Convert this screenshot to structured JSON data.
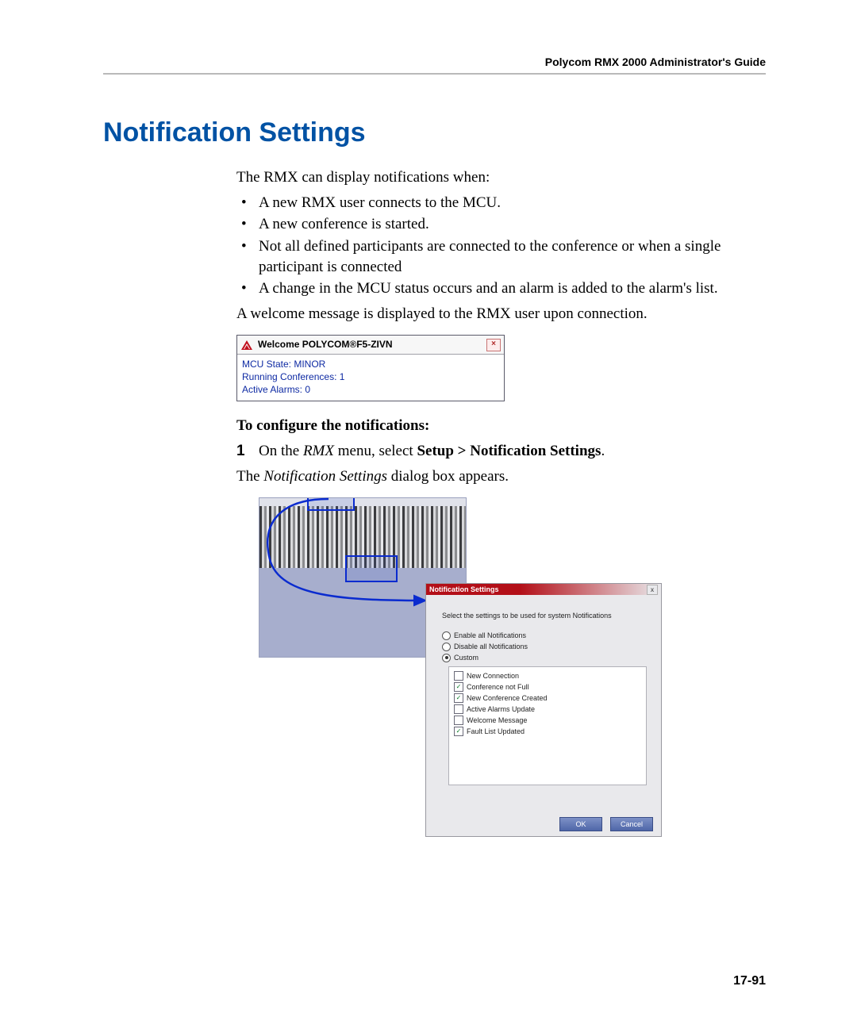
{
  "header": {
    "guide_title": "Polycom RMX 2000 Administrator's Guide"
  },
  "title": "Notification Settings",
  "intro": "The RMX can display notifications when:",
  "bullets": [
    "A new RMX user connects to the MCU.",
    "A new conference is started.",
    "Not all defined participants are connected to the conference or when a single participant is connected",
    "A change in the MCU status occurs and an alarm is added to the alarm's list."
  ],
  "welcome_intro": "A welcome message is displayed to the RMX user upon connection.",
  "welcome": {
    "title": "Welcome POLYCOM®F5-ZIVN",
    "line1": "MCU State: MINOR",
    "line2": "Running Conferences: 1",
    "line3": "Active Alarms: 0",
    "close_glyph": "×"
  },
  "configure_heading": "To configure the notifications:",
  "step1": {
    "num": "1",
    "pre": "On the ",
    "italic1": "RMX",
    "mid": " menu, select ",
    "bold": "Setup > Notification Settings",
    "post": "."
  },
  "step1_result": {
    "pre": "The ",
    "italic": "Notification Settings",
    "post": " dialog box appears."
  },
  "dialog": {
    "title": "Notification Settings",
    "instruction": "Select the settings to be used for system Notifications",
    "radios": [
      {
        "label": "Enable all Notifications",
        "selected": false
      },
      {
        "label": "Disable all Notifications",
        "selected": false
      },
      {
        "label": "Custom",
        "selected": true
      }
    ],
    "options": [
      {
        "label": "New Connection",
        "checked": false
      },
      {
        "label": "Conference not Full",
        "checked": true
      },
      {
        "label": "New Conference Created",
        "checked": true
      },
      {
        "label": "Active Alarms Update",
        "checked": false
      },
      {
        "label": "Welcome Message",
        "checked": false
      },
      {
        "label": "Fault List Updated",
        "checked": true
      }
    ],
    "ok": "OK",
    "cancel": "Cancel",
    "x": "x"
  },
  "page_number": "17-91"
}
